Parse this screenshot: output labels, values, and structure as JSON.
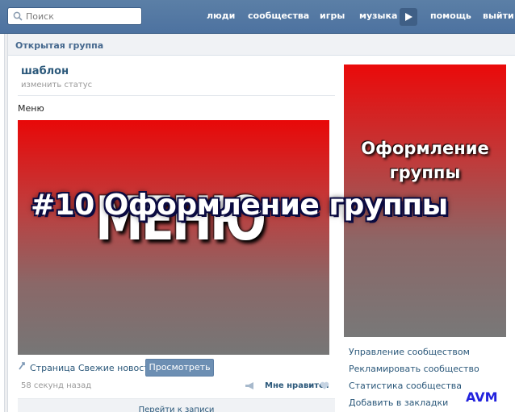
{
  "search": {
    "placeholder": "Поиск",
    "icon": "search-icon"
  },
  "nav": {
    "people": "люди",
    "communities": "сообщества",
    "games": "игры",
    "music": "музыка",
    "help": "помощь",
    "logout": "выйти",
    "play_icon": "play-icon"
  },
  "group": {
    "type_label": "Открытая группа",
    "name": "шаблон",
    "status": "изменить статус",
    "menu_label": "Меню",
    "menu_image_text": "МЕНЮ",
    "wiki_link": "Страница Свежие новости",
    "view_button": "Просмотреть",
    "time": "58 секунд назад",
    "like": "Мне нравится",
    "goto_posts": "Перейти к записи"
  },
  "side": {
    "cover_line1": "Оформление",
    "cover_line2": "группы",
    "links": [
      "Управление сообществом",
      "Рекламировать сообщество",
      "Статистика сообщества",
      "Добавить в закладки"
    ]
  },
  "overlay": {
    "title": "#10 Оформление группы",
    "watermark": "AVM"
  },
  "colors": {
    "topbar": "#4d72a0",
    "link": "#2b587a",
    "button": "#6d8fb3",
    "banner_red": "#e80808"
  }
}
